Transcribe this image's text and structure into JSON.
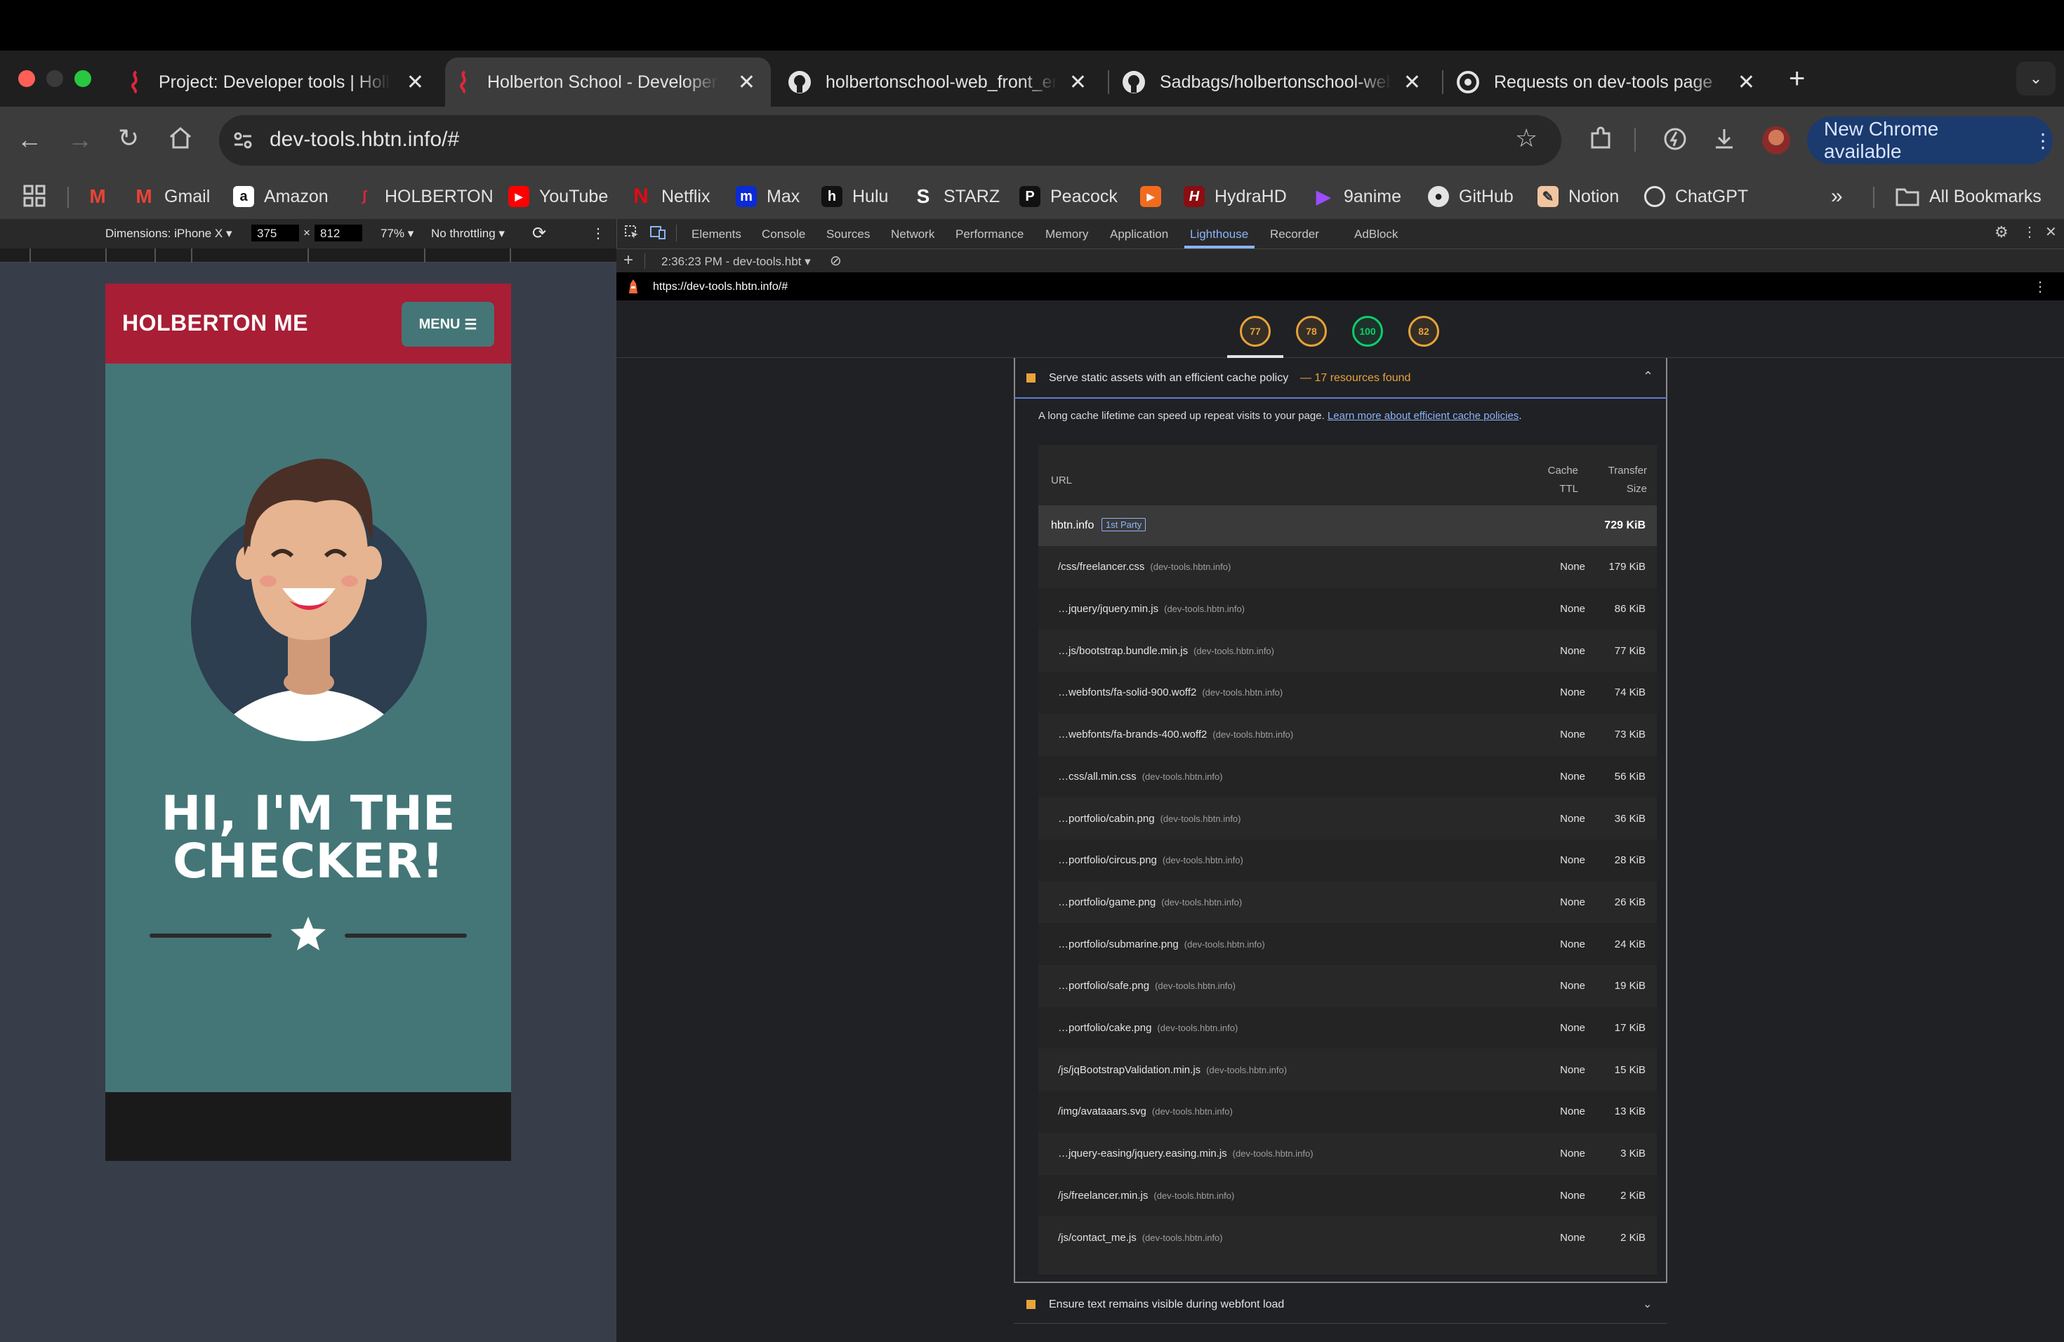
{
  "browser": {
    "tabs": [
      {
        "title": "Project: Developer tools | Holberton",
        "active": false
      },
      {
        "title": "Holberton School - Developer tools",
        "active": true
      },
      {
        "title": "holbertonschool-web_front_end",
        "active": false
      },
      {
        "title": "Sadbags/holbertonschool-web",
        "active": false
      },
      {
        "title": "Requests on dev-tools page",
        "active": false
      }
    ],
    "url": "dev-tools.hbtn.info/#",
    "new_chrome_label": "New Chrome available",
    "bookmarks": [
      "Gmail",
      "Amazon",
      "HOLBERTON",
      "YouTube",
      "Netflix",
      "Max",
      "Hulu",
      "STARZ",
      "Peacock",
      "HydraHD",
      "9anime",
      "GitHub",
      "Notion",
      "ChatGPT"
    ],
    "all_bookmarks_label": "All Bookmarks"
  },
  "device_toolbar": {
    "dimensions_label": "Dimensions: iPhone X",
    "width": "375",
    "height": "812",
    "zoom": "77%",
    "throttling": "No throttling"
  },
  "site": {
    "brand": "HOLBERTON ME",
    "menu_label": "MENU",
    "hero_title_line1": "HI, I'M THE",
    "hero_title_line2": "CHECKER!"
  },
  "devtools": {
    "tabs": [
      "Elements",
      "Console",
      "Sources",
      "Network",
      "Performance",
      "Memory",
      "Application",
      "Lighthouse",
      "Recorder",
      "AdBlock"
    ],
    "active_tab": "Lighthouse",
    "report_selector": "2:36:23 PM - dev-tools.hbt",
    "report_url": "https://dev-tools.hbtn.info/#",
    "scores": [
      {
        "value": "77",
        "color": "#e8a33b"
      },
      {
        "value": "78",
        "color": "#e8a33b"
      },
      {
        "value": "100",
        "color": "#0cce6b"
      },
      {
        "value": "82",
        "color": "#e8a33b"
      }
    ],
    "audit": {
      "title": "Serve static assets with an efficient cache policy",
      "found": "— 17 resources found",
      "description": "A long cache lifetime can speed up repeat visits to your page.",
      "learn_more": "Learn more about efficient cache policies",
      "col_url": "URL",
      "col_ttl_1": "Cache",
      "col_ttl_2": "TTL",
      "col_size_1": "Transfer",
      "col_size_2": "Size",
      "group_name": "hbtn.info",
      "group_badge": "1st Party",
      "group_size": "729 KiB",
      "rows": [
        {
          "url": "/css/freelancer.css",
          "host": "(dev-tools.hbtn.info)",
          "ttl": "None",
          "size": "179 KiB"
        },
        {
          "url": "…jquery/jquery.min.js",
          "host": "(dev-tools.hbtn.info)",
          "ttl": "None",
          "size": "86 KiB"
        },
        {
          "url": "…js/bootstrap.bundle.min.js",
          "host": "(dev-tools.hbtn.info)",
          "ttl": "None",
          "size": "77 KiB"
        },
        {
          "url": "…webfonts/fa-solid-900.woff2",
          "host": "(dev-tools.hbtn.info)",
          "ttl": "None",
          "size": "74 KiB"
        },
        {
          "url": "…webfonts/fa-brands-400.woff2",
          "host": "(dev-tools.hbtn.info)",
          "ttl": "None",
          "size": "73 KiB"
        },
        {
          "url": "…css/all.min.css",
          "host": "(dev-tools.hbtn.info)",
          "ttl": "None",
          "size": "56 KiB"
        },
        {
          "url": "…portfolio/cabin.png",
          "host": "(dev-tools.hbtn.info)",
          "ttl": "None",
          "size": "36 KiB"
        },
        {
          "url": "…portfolio/circus.png",
          "host": "(dev-tools.hbtn.info)",
          "ttl": "None",
          "size": "28 KiB"
        },
        {
          "url": "…portfolio/game.png",
          "host": "(dev-tools.hbtn.info)",
          "ttl": "None",
          "size": "26 KiB"
        },
        {
          "url": "…portfolio/submarine.png",
          "host": "(dev-tools.hbtn.info)",
          "ttl": "None",
          "size": "24 KiB"
        },
        {
          "url": "…portfolio/safe.png",
          "host": "(dev-tools.hbtn.info)",
          "ttl": "None",
          "size": "19 KiB"
        },
        {
          "url": "…portfolio/cake.png",
          "host": "(dev-tools.hbtn.info)",
          "ttl": "None",
          "size": "17 KiB"
        },
        {
          "url": "/js/jqBootstrapValidation.min.js",
          "host": "(dev-tools.hbtn.info)",
          "ttl": "None",
          "size": "15 KiB"
        },
        {
          "url": "/img/avataaars.svg",
          "host": "(dev-tools.hbtn.info)",
          "ttl": "None",
          "size": "13 KiB"
        },
        {
          "url": "…jquery-easing/jquery.easing.min.js",
          "host": "(dev-tools.hbtn.info)",
          "ttl": "None",
          "size": "3 KiB"
        },
        {
          "url": "/js/freelancer.min.js",
          "host": "(dev-tools.hbtn.info)",
          "ttl": "None",
          "size": "2 KiB"
        },
        {
          "url": "/js/contact_me.js",
          "host": "(dev-tools.hbtn.info)",
          "ttl": "None",
          "size": "2 KiB"
        }
      ]
    },
    "next_audit": "Ensure text remains visible during webfont load"
  },
  "colors": {
    "accent_red": "#a81e35",
    "teal": "#447677",
    "score_orange": "#e8a33b",
    "score_green": "#0cce6b",
    "link_blue": "#8ab4f8"
  }
}
